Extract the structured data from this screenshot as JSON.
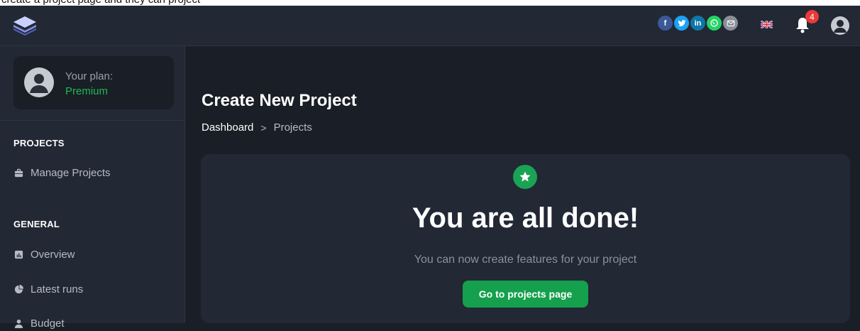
{
  "top_strip": {
    "text": "create a project page and they can project"
  },
  "header": {
    "social": [
      {
        "name": "facebook-icon",
        "glyph": "f",
        "color": "#3b5998"
      },
      {
        "name": "twitter-icon",
        "glyph": "t",
        "color": "#1da1f2"
      },
      {
        "name": "linkedin-icon",
        "glyph": "in",
        "color": "#0e76a8"
      },
      {
        "name": "whatsapp-icon",
        "glyph": "w",
        "color": "#25d366"
      },
      {
        "name": "email-icon",
        "glyph": "✉",
        "color": "#8a8f98"
      }
    ],
    "language": "uk-flag-icon",
    "notifications_count": "4"
  },
  "sidebar": {
    "plan_label": "Your plan:",
    "plan_value": "Premium",
    "sections": [
      {
        "title": "PROJECTS",
        "items": [
          {
            "label": "Manage Projects",
            "icon": "briefcase-icon"
          }
        ]
      },
      {
        "title": "GENERAL",
        "items": [
          {
            "label": "Overview",
            "icon": "chart-icon"
          },
          {
            "label": "Latest runs",
            "icon": "pie-chart-icon"
          },
          {
            "label": "Budget",
            "icon": "user-icon"
          }
        ]
      }
    ]
  },
  "main": {
    "title": "Create New Project",
    "breadcrumb": {
      "link": "Dashboard",
      "separator": ">",
      "current": "Projects"
    },
    "card": {
      "heading": "You are all done!",
      "subtext": "You can now create features for your project",
      "button": "Go to projects page"
    }
  },
  "colors": {
    "accent": "#1db954",
    "button": "#14a04c",
    "background": "#1a1e26",
    "panel": "#222834"
  }
}
